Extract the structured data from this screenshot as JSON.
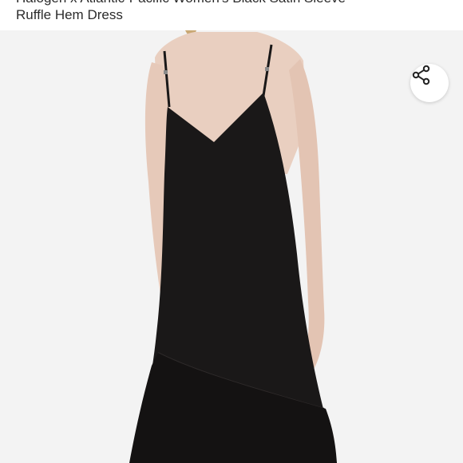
{
  "product": {
    "title_line1": "Halogen x Atlantic-Pacific Women's Black Satin Sleeve",
    "title_line2": "Ruffle Hem Dress"
  },
  "actions": {
    "share_icon": "share-icon"
  },
  "colors": {
    "dress": "#1a1818",
    "skin": "#e9cfc0",
    "background": "#f3f3f3"
  }
}
